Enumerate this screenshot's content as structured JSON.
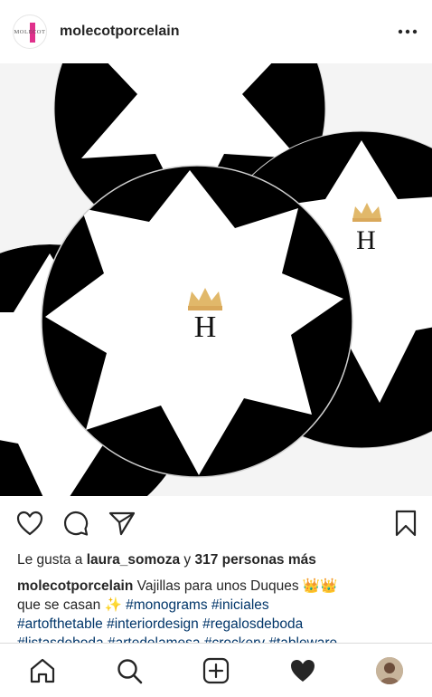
{
  "post": {
    "username": "molecotporcelain",
    "avatar_brand": "MOLECOT",
    "liked_by_prefix": "Le gusta a ",
    "liked_by_user": "laura_somoza",
    "liked_by_join": " y ",
    "liked_by_others": "317 personas más",
    "caption": {
      "username": "molecotporcelain",
      "text_1": " Vajillas para unos Duques ",
      "emoji_crowns": "👑👑",
      "text_2": "que se casan ",
      "emoji_sparkles": "✨",
      "hashtags": [
        "#monograms",
        "#iniciales",
        "#artofthetable",
        "#interiordesign",
        "#regalosdeboda",
        "#listasdeboda",
        "#artedelamesa",
        "#crockery",
        "#tableware"
      ]
    },
    "photo": {
      "monogram": "H",
      "colors": {
        "background": "#f4f4f4",
        "plate": "#ffffff",
        "pattern": "#000000",
        "crown": "#e1b86a"
      }
    }
  },
  "icons": {
    "more": "more-dots-icon",
    "like": "heart-outline-icon",
    "comment": "comment-bubble-icon",
    "share": "paper-plane-icon",
    "save": "bookmark-icon"
  },
  "tabbar": {
    "items": [
      "home-icon",
      "search-icon",
      "add-post-icon",
      "activity-heart-icon",
      "profile-avatar"
    ]
  },
  "colors": {
    "text": "#262626",
    "hashtag": "#003569",
    "divider": "#dbdbdb"
  }
}
